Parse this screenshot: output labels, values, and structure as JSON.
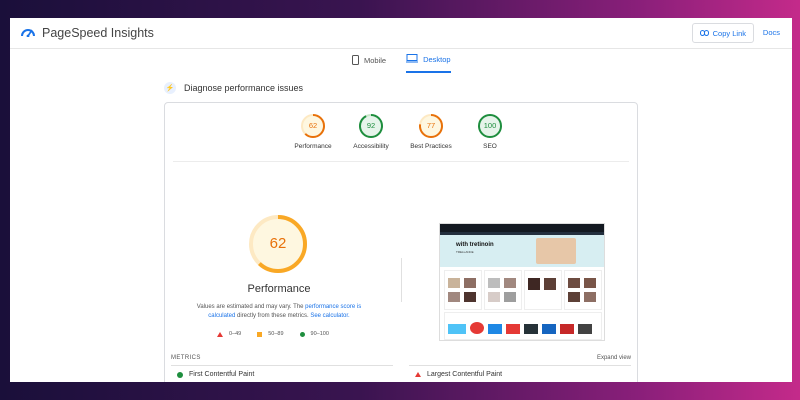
{
  "app": {
    "title": "PageSpeed Insights"
  },
  "header": {
    "copy_link": "Copy Link",
    "docs": "Docs"
  },
  "tabs": [
    {
      "label": "Mobile",
      "active": false
    },
    {
      "label": "Desktop",
      "active": true
    }
  ],
  "diagnose": {
    "title": "Diagnose performance issues"
  },
  "scores": [
    {
      "label": "Performance",
      "value": "62",
      "color": "#e8710a"
    },
    {
      "label": "Accessibility",
      "value": "92",
      "color": "#1e8e3e"
    },
    {
      "label": "Best Practices",
      "value": "77",
      "color": "#e8710a"
    },
    {
      "label": "SEO",
      "value": "100",
      "color": "#1e8e3e"
    }
  ],
  "performance": {
    "score": "62",
    "title": "Performance",
    "desc_pre": "Values are estimated and may vary. The ",
    "desc_link1": "performance score is calculated",
    "desc_mid": " directly from these metrics. ",
    "desc_link2": "See calculator."
  },
  "legend": [
    {
      "label": "0–49"
    },
    {
      "label": "50–89"
    },
    {
      "label": "90–100"
    }
  ],
  "screenshot": {
    "hero_text": "with tretinoin",
    "hero_sub": "TRELLANCE"
  },
  "metrics": {
    "heading": "METRICS",
    "expand": "Expand view",
    "items": [
      {
        "label": "First Contentful Paint",
        "status": "good"
      },
      {
        "label": "Largest Contentful Paint",
        "status": "poor"
      }
    ]
  },
  "colors": {
    "good": "#1e8e3e",
    "average": "#e8710a",
    "poor": "#e53935",
    "accent": "#1a73e8"
  }
}
